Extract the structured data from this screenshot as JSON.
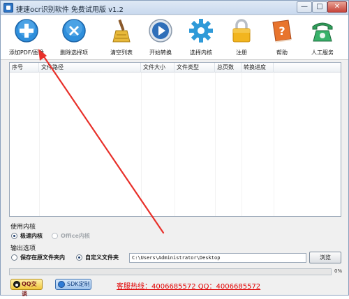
{
  "window": {
    "title": "捷速ocr识别软件 免费试用版 v1.2",
    "min_label": "—",
    "max_label": "□",
    "close_label": "✕"
  },
  "toolbar": {
    "items": [
      {
        "label": "添加PDF/图像",
        "icon": "add-icon"
      },
      {
        "label": "删除选择项",
        "icon": "delete-icon"
      },
      {
        "label": "清空列表",
        "icon": "broom-icon"
      },
      {
        "label": "开始转换",
        "icon": "play-icon"
      },
      {
        "label": "选择内核",
        "icon": "gear-icon"
      },
      {
        "label": "注册",
        "icon": "lock-icon"
      },
      {
        "label": "帮助",
        "icon": "help-book-icon"
      },
      {
        "label": "人工服务",
        "icon": "phone-icon"
      }
    ]
  },
  "table": {
    "columns": [
      "序号",
      "文件路径",
      "文件大小",
      "文件类型",
      "总页数",
      "转换进度"
    ],
    "rows": []
  },
  "kernel": {
    "section_label": "使用内核",
    "options": [
      {
        "label": "极速内核",
        "selected": true,
        "disabled": false
      },
      {
        "label": "Office内核",
        "selected": false,
        "disabled": true
      }
    ]
  },
  "output": {
    "section_label": "输出选项",
    "options": [
      {
        "label": "保存在原文件夹内",
        "selected": false
      },
      {
        "label": "自定义文件夹",
        "selected": true
      }
    ],
    "path_value": "C:\\Users\\Administrator\\Desktop",
    "browse_label": "浏览"
  },
  "progress": {
    "value": 0,
    "label": "0%"
  },
  "footer": {
    "qq_label": "QQ交谈",
    "sdk_label": "SDK定制",
    "hotline": "客服热线：4006685572 QQ：4006685572"
  },
  "colors": {
    "annotation_arrow": "#e8302a",
    "hotline": "#e00000",
    "progress_fill": "#4fb34c"
  }
}
